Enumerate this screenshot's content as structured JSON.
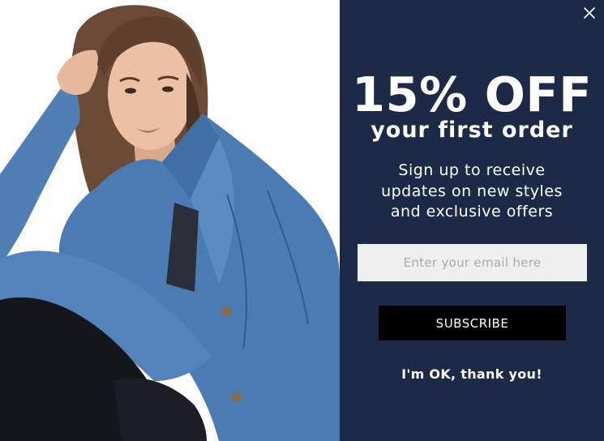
{
  "popup": {
    "photo_alt": "Woman wearing a denim jacket",
    "close_icon": "close-icon",
    "headline": "15% OFF",
    "subhead": "your first order",
    "blurb": "Sign up to receive updates on new styles and exclusive offers",
    "email": {
      "placeholder": "Enter your email here",
      "value": ""
    },
    "subscribe_label": "SUBSCRIBE",
    "decline_label": "I'm OK, thank you!"
  },
  "colors": {
    "panel": "#1d2a47",
    "button": "#000000",
    "input": "#efefef",
    "text": "#ffffff"
  }
}
